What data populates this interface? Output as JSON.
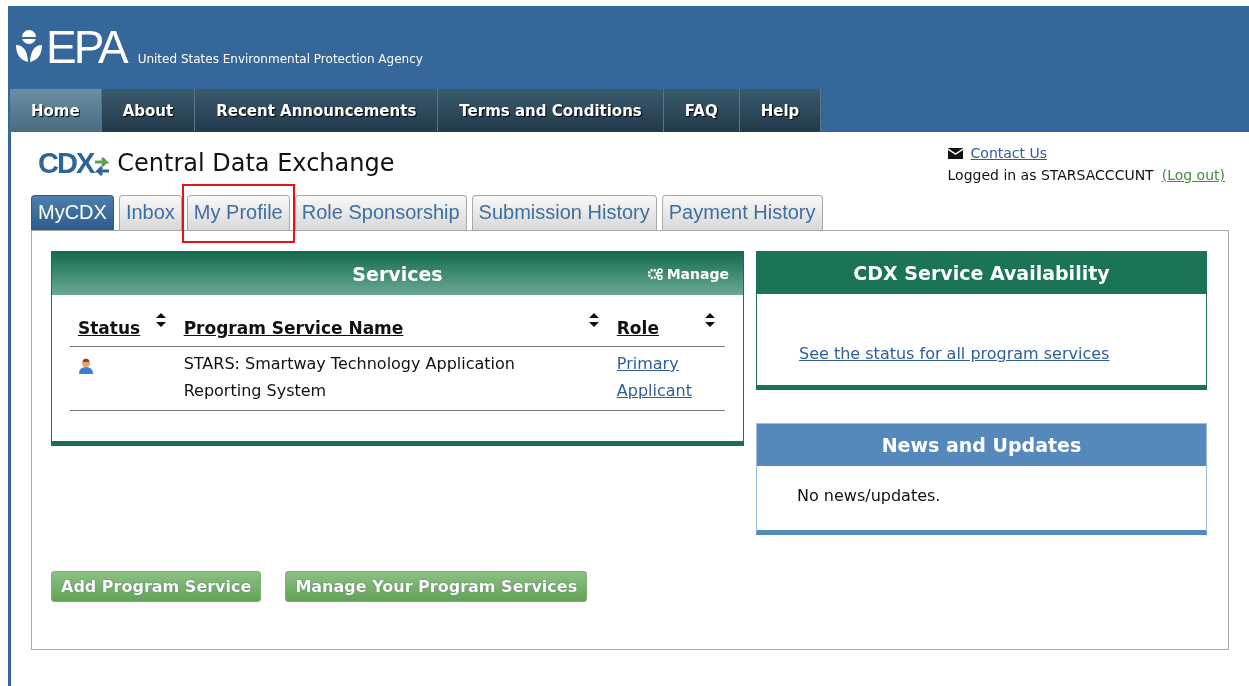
{
  "header": {
    "logo_text": "EPA",
    "agency": "United States Environmental Protection Agency"
  },
  "nav": [
    {
      "label": "Home",
      "selected": true
    },
    {
      "label": "About",
      "selected": false
    },
    {
      "label": "Recent Announcements",
      "selected": false
    },
    {
      "label": "Terms and Conditions",
      "selected": false
    },
    {
      "label": "FAQ",
      "selected": false
    },
    {
      "label": "Help",
      "selected": false
    }
  ],
  "site": {
    "logo_text": "CDX",
    "title": "Central Data Exchange"
  },
  "user_box": {
    "contact": "Contact Us",
    "logged_in": "Logged in as STARSACCCUNT",
    "logout": "(Log out)"
  },
  "tabs": [
    {
      "label": "MyCDX",
      "selected": true,
      "highlighted": false
    },
    {
      "label": "Inbox",
      "selected": false,
      "highlighted": false
    },
    {
      "label": "My Profile",
      "selected": false,
      "highlighted": true
    },
    {
      "label": "Role Sponsorship",
      "selected": false,
      "highlighted": false
    },
    {
      "label": "Submission History",
      "selected": false,
      "highlighted": false
    },
    {
      "label": "Payment History",
      "selected": false,
      "highlighted": false
    }
  ],
  "services": {
    "title": "Services",
    "manage": "Manage",
    "columns": [
      "Status",
      "Program Service Name",
      "Role"
    ],
    "rows": [
      {
        "service": "STARS: Smartway Technology Application Reporting System",
        "role": "Primary Applicant"
      }
    ]
  },
  "availability": {
    "title": "CDX Service Availability",
    "link": "See the status for all program services"
  },
  "news": {
    "title": "News and Updates",
    "text": "No news/updates."
  },
  "buttons": [
    "Add Program Service",
    "Manage Your Program Services"
  ]
}
